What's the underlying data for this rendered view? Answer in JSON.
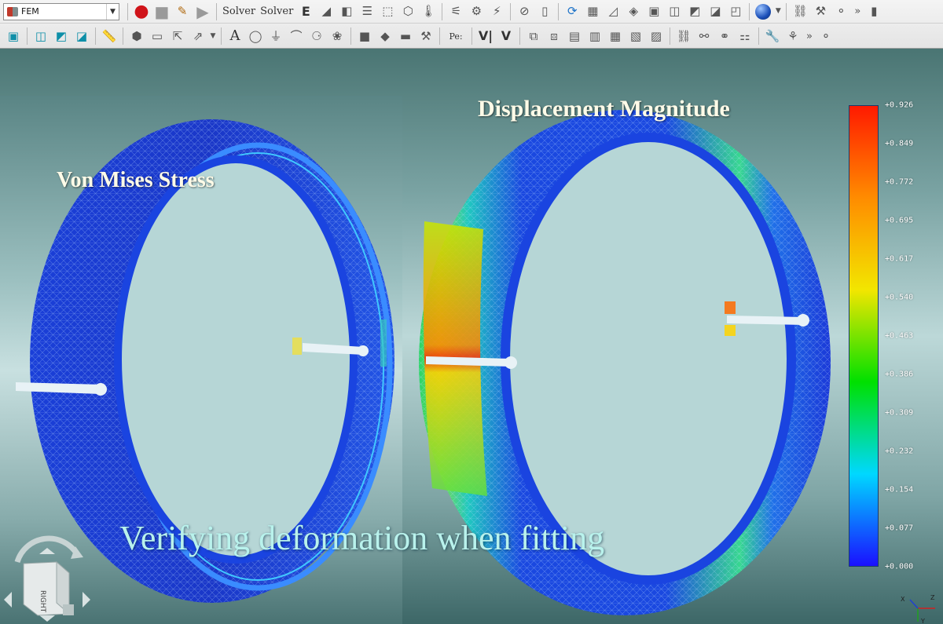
{
  "toolbar": {
    "module": {
      "selected": "FEM",
      "icon": "fem-module-icon"
    },
    "row1": {
      "run": "record-icon",
      "stop": "stop-icon",
      "edit": "edit-analysis-icon",
      "play": "play-icon",
      "solver_label_1": "Solver",
      "solver_label_2": "Solver",
      "elmer_label": "E",
      "more": "»"
    },
    "row2": {
      "text_tool": "A",
      "pe_label": "Pe:",
      "v1_label": "V|",
      "v2_label": "V",
      "more": "»"
    }
  },
  "viewport": {
    "label_left": "Von Mises Stress",
    "label_right": "Displacement Magnitude",
    "caption": "Verifying deformation when fitting",
    "navcube_face": "RIGHT",
    "axis_x": "X",
    "axis_y": "Y",
    "axis_z": "Z"
  },
  "legend": {
    "colors": [
      "#ff1a00",
      "#ff8c00",
      "#f2e600",
      "#00e000",
      "#00d8ff",
      "#1a10ff"
    ],
    "ticks": [
      "+0.926",
      "+0.849",
      "+0.772",
      "+0.695",
      "+0.617",
      "+0.540",
      "+0.463",
      "+0.386",
      "+0.309",
      "+0.232",
      "+0.154",
      "+0.077",
      "+0.000"
    ]
  }
}
